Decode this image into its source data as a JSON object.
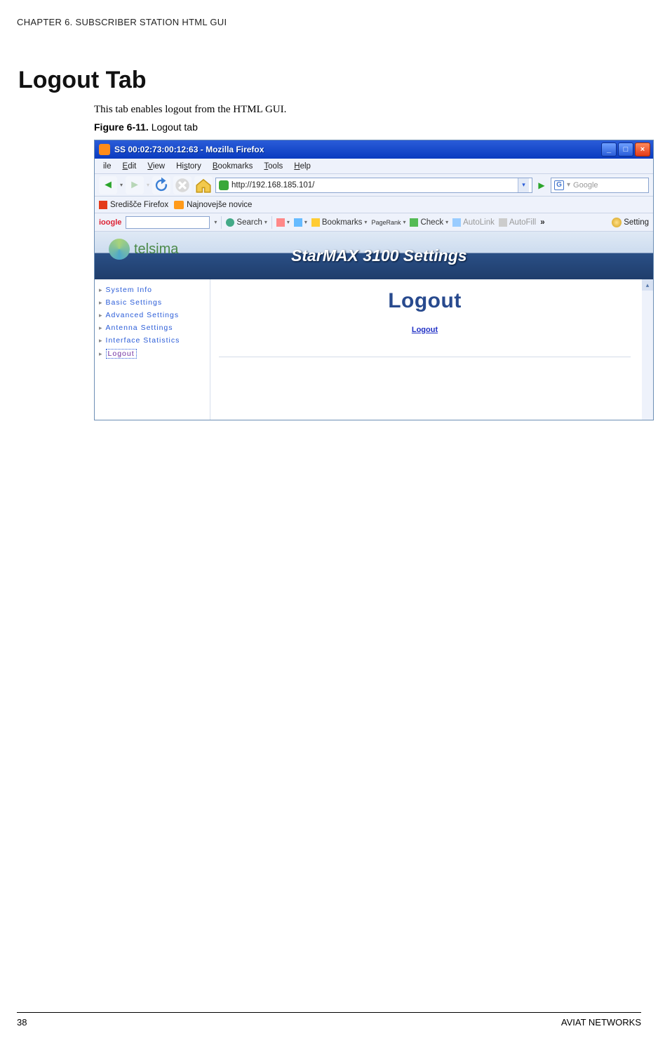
{
  "header": {
    "chapter": "CHAPTER 6. SUBSCRIBER STATION HTML GUI"
  },
  "section": {
    "title": "Logout Tab",
    "intro": "This tab enables logout from the HTML GUI."
  },
  "figure": {
    "label": "Figure 6-11.",
    "caption": "Logout tab"
  },
  "browser": {
    "title": "SS 00:02:73:00:12:63 - Mozilla Firefox",
    "menus": {
      "file": "ile",
      "edit": "Edit",
      "view": "View",
      "history": "History",
      "bookmarks": "Bookmarks",
      "tools": "Tools",
      "help": "Help"
    },
    "address": "http://192.168.185.101/",
    "search_placeholder": "Google",
    "bookmarks_bar": {
      "item1": "Središče Firefox",
      "item2": "Najnovejše novice"
    },
    "gtoolbar": {
      "logo": "ioogle",
      "search": "Search",
      "bookmarks": "Bookmarks",
      "pagerank": "PageRank",
      "check": "Check",
      "autolink": "AutoLink",
      "autofill": "AutoFill",
      "more": "»",
      "settings": "Setting"
    }
  },
  "app": {
    "logo_text": "telsima",
    "banner_title": "StarMAX 3100 Settings",
    "sidebar": {
      "items": [
        {
          "label": "System Info"
        },
        {
          "label": "Basic Settings"
        },
        {
          "label": "Advanced Settings"
        },
        {
          "label": "Antenna Settings"
        },
        {
          "label": "Interface Statistics"
        },
        {
          "label": "Logout"
        }
      ]
    },
    "content": {
      "title": "Logout",
      "link": "Logout"
    }
  },
  "footer": {
    "page": "38",
    "company": "AVIAT NETWORKS"
  }
}
